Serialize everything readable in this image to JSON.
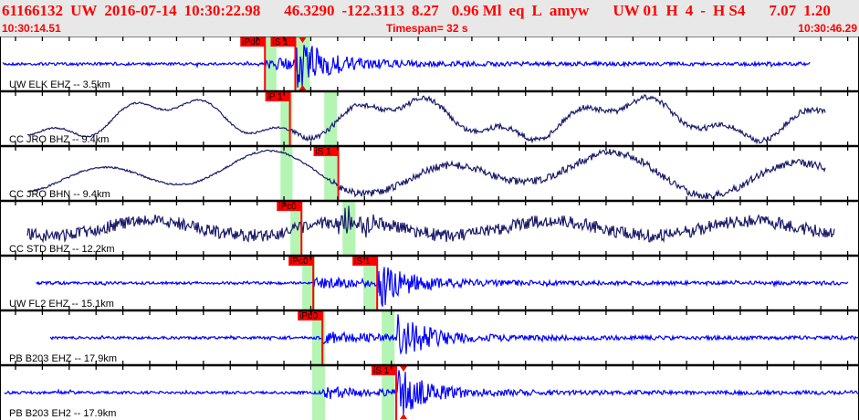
{
  "header": {
    "summary_fields": [
      "61166132",
      "UW",
      "2016-07-14",
      "10:30:22.98",
      "46.3290",
      "-122.3113",
      "8.27",
      "0.96 Ml",
      "eq",
      "L",
      "amyw",
      "UW 01",
      "H",
      "4",
      "-",
      "H S4",
      "7.07",
      "1.20"
    ],
    "start_time": "10:30:14.51",
    "timespan": "Timespan=  32 s",
    "end_time": "10:30:46.29"
  },
  "channels": [
    {
      "label": "UW ELK EHZ -- 3.5km",
      "color": "#0000ff",
      "picks": [
        {
          "label": "iPd0",
          "t": 9.87
        },
        {
          "label": "iS 1",
          "t": 11.0
        }
      ],
      "green_windows": [
        [
          9.87,
          10.3
        ],
        [
          11.0,
          11.55
        ]
      ]
    },
    {
      "label": "CC JRO BHZ -- 9.4km",
      "color": "#1c1c6a",
      "picks": [
        {
          "label": "iP 1",
          "t": 10.8
        }
      ],
      "green_windows": [
        [
          10.45,
          10.9
        ],
        [
          12.08,
          12.55
        ]
      ]
    },
    {
      "label": "CC JRO BHN -- 9.4km",
      "color": "#1c1c6a",
      "picks": [
        {
          "label": "iS 1",
          "t": 12.6
        }
      ],
      "green_windows": [
        [
          10.45,
          10.9
        ],
        [
          12.08,
          12.55
        ]
      ]
    },
    {
      "label": "CC STD BHZ -- 12.2km",
      "color": "#1c1c6a",
      "picks": [
        {
          "label": "iPc0",
          "t": 11.23
        }
      ],
      "green_windows": [
        [
          10.82,
          11.27
        ],
        [
          12.76,
          13.24
        ]
      ]
    },
    {
      "label": "UW FL2 EHZ -- 15.1km",
      "color": "#0000ff",
      "picks": [
        {
          "label": "iPc0",
          "t": 11.67
        },
        {
          "label": "iS 1",
          "t": 14.05
        }
      ],
      "green_windows": [
        [
          11.26,
          11.73
        ],
        [
          13.54,
          14.02
        ]
      ]
    },
    {
      "label": "PB B203 EHZ -- 17.9km",
      "color": "#0000ff",
      "picks": [
        {
          "label": "iPd0",
          "t": 12.01
        }
      ],
      "green_windows": [
        [
          11.63,
          12.11
        ],
        [
          14.22,
          14.7
        ]
      ]
    },
    {
      "label": "PB B203 EH2 -- 17.9km",
      "color": "#0000ff",
      "picks": [
        {
          "label": "iS 1",
          "t": 14.76
        }
      ],
      "green_windows": [
        [
          11.63,
          12.11
        ],
        [
          14.22,
          14.7
        ]
      ]
    }
  ],
  "colors": {
    "header_text": "#ff0000",
    "pick": "#ff0000",
    "window": "#b4f5b4"
  }
}
